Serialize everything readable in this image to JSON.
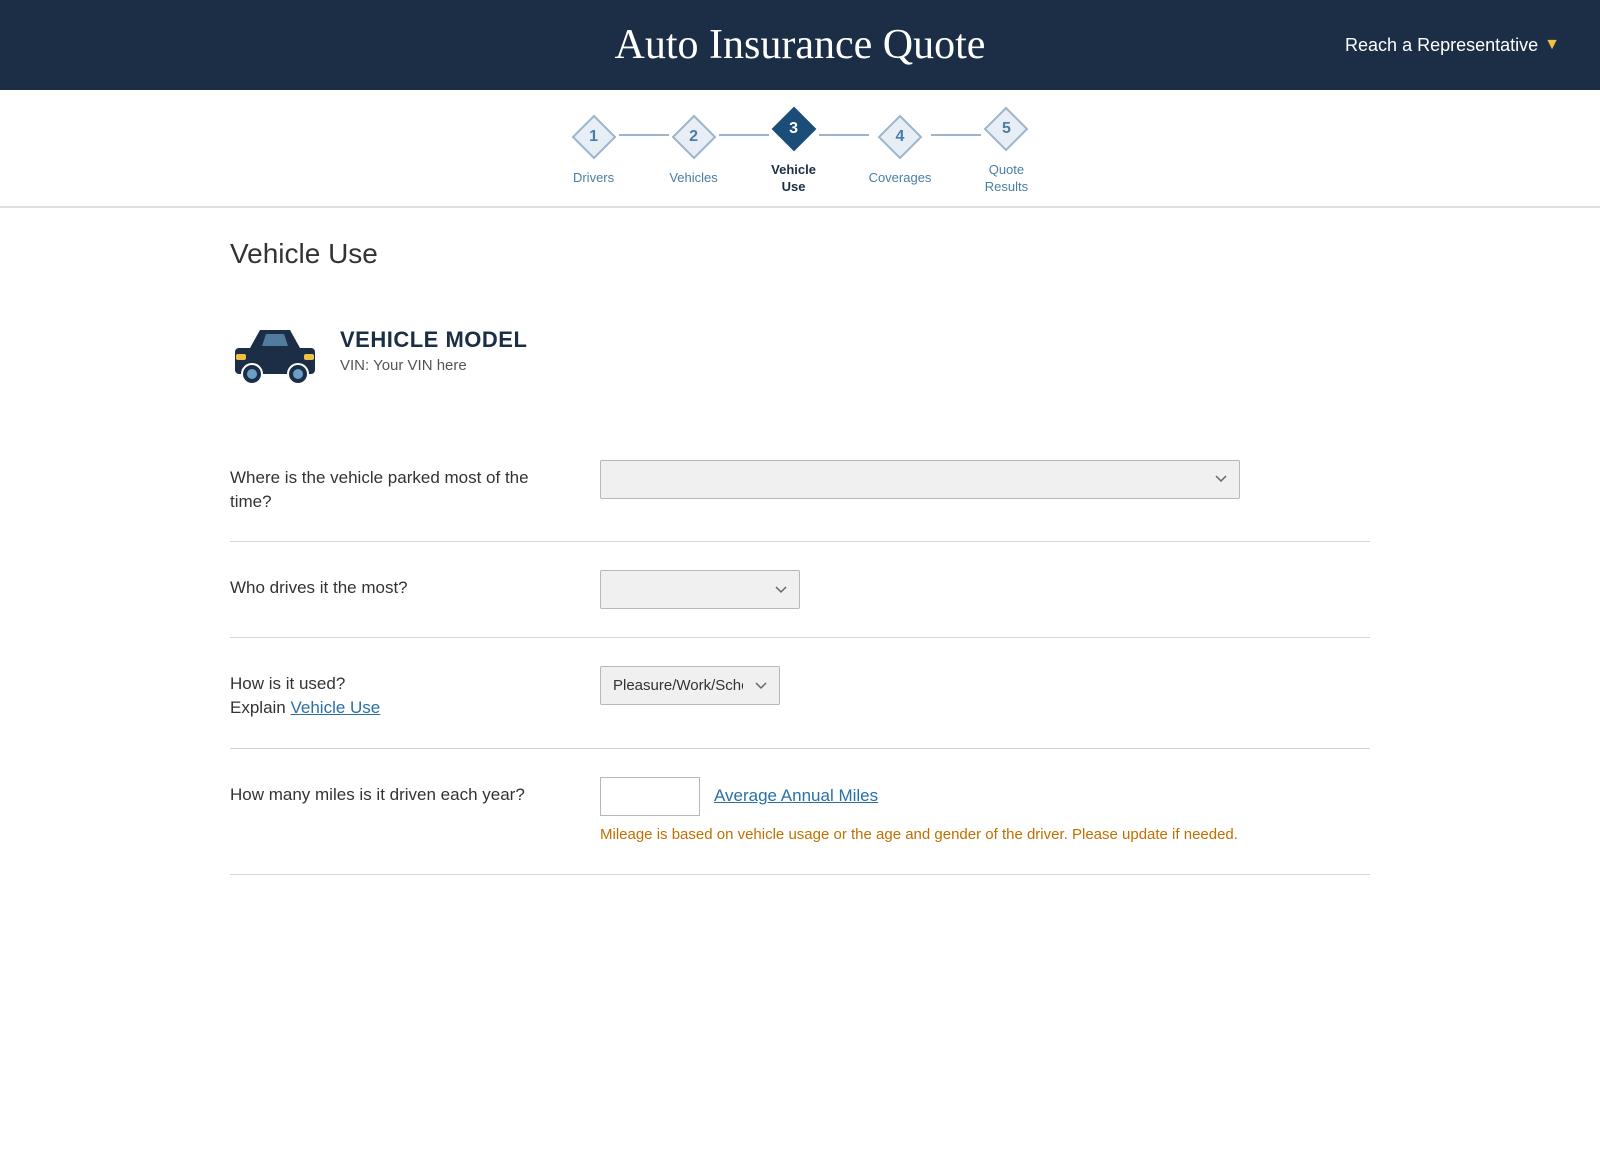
{
  "header": {
    "title": "Auto Insurance Quote",
    "reach_rep_label": "Reach a Representative"
  },
  "steps": [
    {
      "number": "1",
      "label": "Drivers",
      "active": false
    },
    {
      "number": "2",
      "label": "Vehicles",
      "active": false
    },
    {
      "number": "3",
      "label": "Vehicle\nUse",
      "active": true
    },
    {
      "number": "4",
      "label": "Coverages",
      "active": false
    },
    {
      "number": "5",
      "label": "Quote\nResults",
      "active": false
    }
  ],
  "page": {
    "title": "Vehicle Use"
  },
  "vehicle": {
    "model": "VEHICLE MODEL",
    "vin_label": "VIN: Your VIN here"
  },
  "form": {
    "parked_question": "Where is the vehicle parked most of the time?",
    "parked_placeholder": "",
    "driver_question": "Who drives it the most?",
    "driver_placeholder": "",
    "usage_question": "How is it used?",
    "usage_explain_prefix": "Explain ",
    "usage_explain_link": "Vehicle Use",
    "usage_value": "Pleasure/Work/School",
    "miles_question": "How many miles is it driven each year?",
    "miles_value": "",
    "avg_miles_link": "Average Annual Miles",
    "mileage_note": "Mileage is based on vehicle usage or the age and gender of the driver. Please update if needed."
  }
}
